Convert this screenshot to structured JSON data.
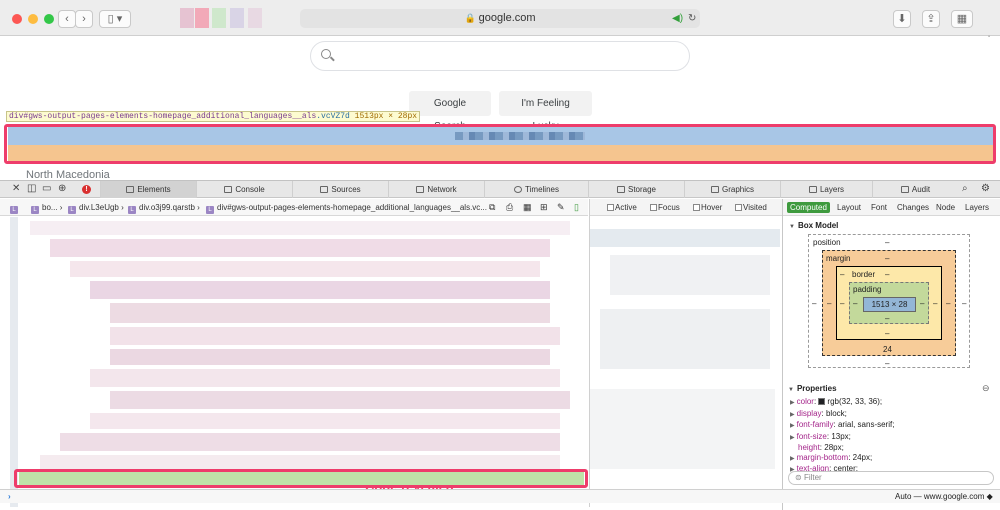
{
  "toolbar": {
    "address": "google.com",
    "icons": [
      "back-icon",
      "forward-icon",
      "sidebar-icon",
      "lock-icon",
      "sound-icon",
      "reload-icon",
      "download-icon",
      "share-icon",
      "tabs-icon",
      "new-tab-icon"
    ],
    "colors": {
      "close": "#fc5753",
      "minimize": "#fdbc40",
      "zoom": "#33c748"
    }
  },
  "page": {
    "search_button": "Google Search",
    "lucky_button": "I'm Feeling Lucky",
    "country": "North Macedonia",
    "tooltip": {
      "tag": "div#gws-output-pages-elements-homepage_additional_languages__als",
      "cls": ".vcVZ7d",
      "dims": "1513px × 28px"
    }
  },
  "devtools": {
    "tabs": [
      "Elements",
      "Console",
      "Sources",
      "Network",
      "Timelines",
      "Storage",
      "Graphics",
      "Layers",
      "Audit"
    ],
    "active_tab": "Elements",
    "error_count": "!",
    "breadcrumbs": [
      "bo...",
      "div.L3eUgb",
      "div.o3j99.qarstb",
      "div#gws-output-pages-elements-homepage_additional_languages__als.vc..."
    ],
    "pseudo_classes": [
      "Active",
      "Focus",
      "Hover",
      "Visited"
    ],
    "sidebar_tabs": [
      "Computed",
      "Layout",
      "Font",
      "Changes",
      "Node",
      "Layers"
    ],
    "active_sidebar_tab": "Computed",
    "box_model": {
      "title": "Box Model",
      "position_label": "position",
      "margin_label": "margin",
      "border_label": "border",
      "padding_label": "padding",
      "content": "1513 × 28",
      "dash": "–",
      "margin_bottom": "24"
    },
    "properties": {
      "title": "Properties",
      "items": [
        {
          "name": "color",
          "value": "rgb(32, 33, 36);"
        },
        {
          "name": "display",
          "value": "block;"
        },
        {
          "name": "font-family",
          "value": "arial, sans-serif;"
        },
        {
          "name": "font-size",
          "value": "13px;"
        },
        {
          "name": "height",
          "value": "28px;"
        },
        {
          "name": "margin-bottom",
          "value": "24px;"
        },
        {
          "name": "text-align",
          "value": "center;"
        }
      ]
    },
    "filter_placeholder": "Filter",
    "console_prompt": "›",
    "console_context": "Auto — www.google.com",
    "annotation": "Code revealed.",
    "accent_colors": {
      "highlight_pink": "#ee3d6b",
      "content_blue": "#a8c6e6",
      "margin_orange": "#f5c58f",
      "active_green": "#3e9a3e"
    }
  }
}
